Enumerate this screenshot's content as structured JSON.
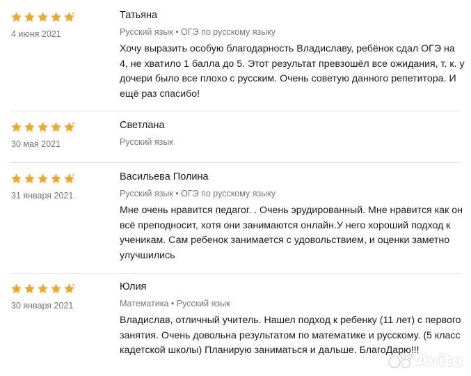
{
  "colors": {
    "star": "#f5a623",
    "text_primary": "#1a1a1a",
    "text_secondary": "#757575",
    "divider": "#e4e4e4"
  },
  "reviews": [
    {
      "author": "Татьяна",
      "date": "4 июня 2021",
      "rating": 5,
      "tags": "Русский язык • ОГЭ по русскому языку",
      "text": "Хочу выразить особую благодарность Владиславу, ребёнок сдал ОГЭ на 4, не хватило 1 балла до 5. Этот результат превзошёл все ожидания, т. к. у дочери было все плохо с русским. Очень советую данного репетитора. И ещё раз спасибо!"
    },
    {
      "author": "Светлана",
      "date": "30 мая 2021",
      "rating": 5,
      "tags": "Русский язык",
      "text": ""
    },
    {
      "author": "Васильева Полина",
      "date": "31 января 2021",
      "rating": 5,
      "tags": "Русский язык • ОГЭ по русскому языку",
      "text": "Мне очень нравится педагог. . Очень эрудированный. Мне нравится как он всё преподносит, хотя они занимаются онлайн.У него хороший подход к ученикам. Сам ребенок занимается с удовольствием, и оценки заметно улучшились"
    },
    {
      "author": "Юлия",
      "date": "30 января 2021",
      "rating": 5,
      "tags": "Математика • Русский язык",
      "text": "Владислав, отличный учитель. Нашел подход к ребенку (11 лет) с первого занятия. Очень довольна результатом по математике и русскому. (5 класс кадетской школы) Планирую заниматься и дальше. БлагоДарю!!!"
    }
  ],
  "watermark": {
    "text": "Avito",
    "icon": "avito-logo-icon"
  }
}
